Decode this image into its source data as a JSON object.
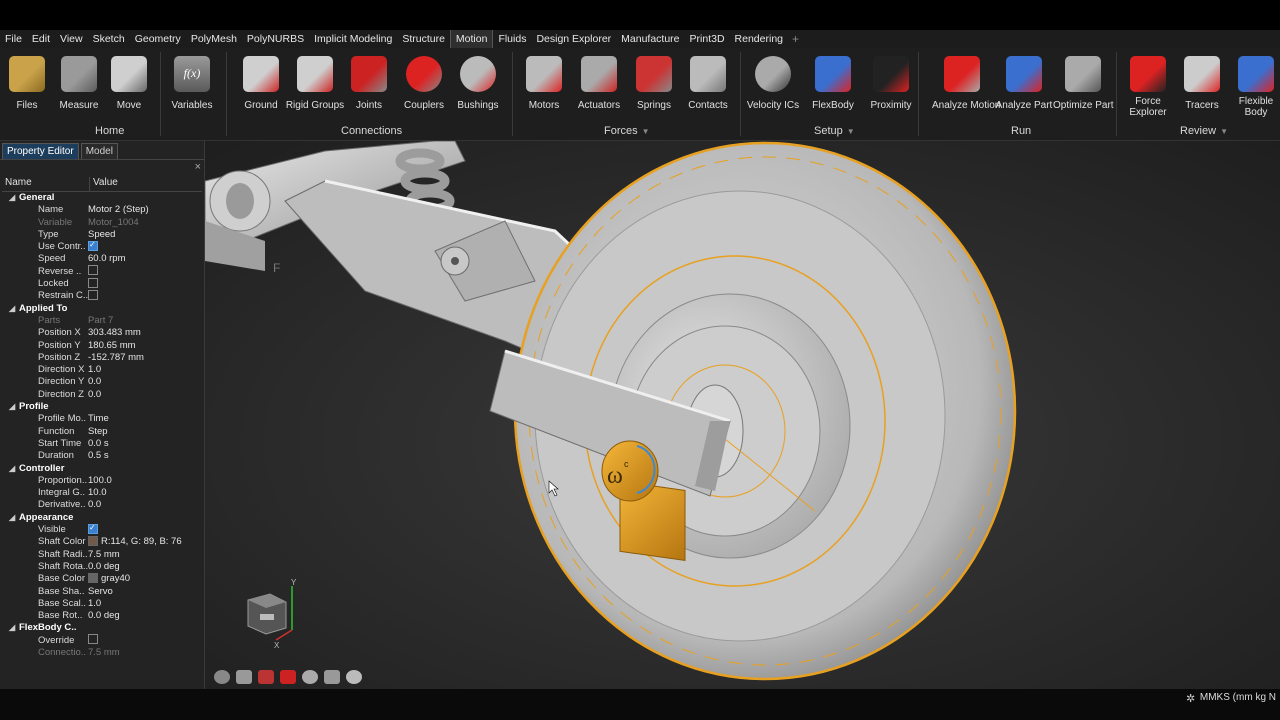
{
  "menu": {
    "items": [
      "File",
      "Edit",
      "View",
      "Sketch",
      "Geometry",
      "PolyMesh",
      "PolyNURBS",
      "Implicit Modeling",
      "Structure",
      "Motion",
      "Fluids",
      "Design Explorer",
      "Manufacture",
      "Print3D",
      "Rendering"
    ],
    "active": "Motion",
    "plus": "+"
  },
  "ribbon": {
    "tools": [
      {
        "label": "Files",
        "icon": "folder-icon"
      },
      {
        "label": "Measure",
        "icon": "measure-icon"
      },
      {
        "label": "Move",
        "icon": "move-icon"
      },
      {
        "label": "Variables",
        "icon": "variables-icon"
      },
      {
        "label": "Ground",
        "icon": "ground-icon"
      },
      {
        "label": "Rigid Groups",
        "icon": "rigid-groups-icon"
      },
      {
        "label": "Joints",
        "icon": "joints-icon"
      },
      {
        "label": "Couplers",
        "icon": "couplers-icon"
      },
      {
        "label": "Bushings",
        "icon": "bushings-icon"
      },
      {
        "label": "Motors",
        "icon": "motors-icon"
      },
      {
        "label": "Actuators",
        "icon": "actuators-icon"
      },
      {
        "label": "Springs",
        "icon": "springs-icon"
      },
      {
        "label": "Contacts",
        "icon": "contacts-icon"
      },
      {
        "label": "Velocity ICs",
        "icon": "velocity-ics-icon"
      },
      {
        "label": "FlexBody",
        "icon": "flexbody-icon"
      },
      {
        "label": "Proximity",
        "icon": "proximity-icon"
      },
      {
        "label": "Analyze Motion",
        "icon": "analyze-motion-icon"
      },
      {
        "label": "Analyze Part",
        "icon": "analyze-part-icon"
      },
      {
        "label": "Optimize Part",
        "icon": "optimize-part-icon"
      },
      {
        "label": "Force\nExplorer",
        "icon": "force-explorer-icon"
      },
      {
        "label": "Tracers",
        "icon": "tracers-icon"
      },
      {
        "label": "Flexible\nBody",
        "icon": "flexible-body-icon"
      }
    ],
    "groups": {
      "home": "Home",
      "connections": "Connections",
      "forces": "Forces",
      "setup": "Setup",
      "run": "Run",
      "review": "Review"
    },
    "caret": "▼",
    "variables_glyph": "f(x)"
  },
  "panel": {
    "tabs": [
      "Property Editor",
      "Model"
    ],
    "close": "×",
    "headers": {
      "name": "Name",
      "value": "Value"
    },
    "triangle": "◢",
    "groups": [
      {
        "title": "General",
        "rows": [
          {
            "name": "Name",
            "value": "Motor 2 (Step)"
          },
          {
            "name": "Variable",
            "value": "Motor_1004",
            "dim": true
          },
          {
            "name": "Type",
            "value": "Speed"
          },
          {
            "name": "Use Contr..",
            "check": true
          },
          {
            "name": "Speed",
            "value": "60.0 rpm"
          },
          {
            "name": "Reverse ..",
            "check": false
          },
          {
            "name": "Locked",
            "check": false
          },
          {
            "name": "Restrain C..",
            "check": false
          }
        ]
      },
      {
        "title": "Applied To",
        "rows": [
          {
            "name": "Parts",
            "value": "Part 7",
            "dim": true
          },
          {
            "name": "Position X",
            "value": "303.483 mm"
          },
          {
            "name": "Position Y",
            "value": "180.65 mm"
          },
          {
            "name": "Position Z",
            "value": "-152.787 mm"
          },
          {
            "name": "Direction X",
            "value": "1.0"
          },
          {
            "name": "Direction Y",
            "value": "0.0"
          },
          {
            "name": "Direction Z",
            "value": "0.0"
          }
        ]
      },
      {
        "title": "Profile",
        "rows": [
          {
            "name": "Profile Mo..",
            "value": "Time"
          },
          {
            "name": "Function",
            "value": "Step"
          },
          {
            "name": "Start Time",
            "value": "0.0 s"
          },
          {
            "name": "Duration",
            "value": "0.5 s"
          }
        ]
      },
      {
        "title": "Controller",
        "rows": [
          {
            "name": "Proportion..",
            "value": "100.0"
          },
          {
            "name": "Integral G..",
            "value": "10.0"
          },
          {
            "name": "Derivative..",
            "value": "0.0"
          }
        ]
      },
      {
        "title": "Appearance",
        "rows": [
          {
            "name": "Visible",
            "check": true
          },
          {
            "name": "Shaft Color",
            "value": "R:114, G: 89, B: 76",
            "swatch": "#72594c"
          },
          {
            "name": "Shaft Radi..",
            "value": "7.5 mm"
          },
          {
            "name": "Shaft Rota..",
            "value": "0.0 deg"
          },
          {
            "name": "Base Color",
            "value": "gray40",
            "swatch": "#666666"
          },
          {
            "name": "Base Sha..",
            "value": "Servo"
          },
          {
            "name": "Base Scal..",
            "value": "1.0"
          },
          {
            "name": "Base Rot..",
            "value": "0.0 deg"
          }
        ]
      },
      {
        "title": "FlexBody C..",
        "rows": [
          {
            "name": "Override",
            "check": false
          },
          {
            "name": "Connectio..",
            "value": "7.5 mm",
            "dim": true
          }
        ]
      }
    ]
  },
  "viewport": {
    "motor_symbol": "ω",
    "motor_superscript": "c",
    "triad_y": "Y",
    "triad_x": "X",
    "letter_f": "F"
  },
  "status": {
    "units": "MMKS (mm kg N"
  },
  "colors": {
    "accent": "#e8a020",
    "tab_active": "#1d3d5c",
    "background": "#1e1e1e"
  }
}
